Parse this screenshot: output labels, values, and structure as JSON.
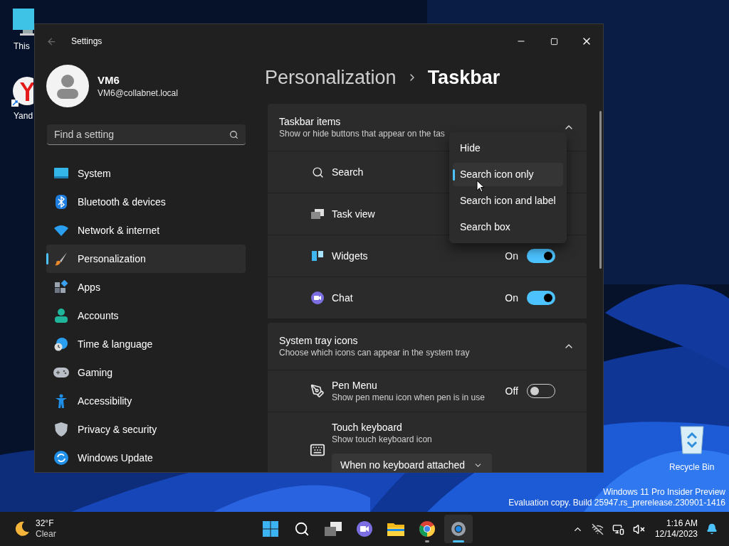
{
  "desktop": {
    "icons": [
      {
        "label": "This"
      },
      {
        "label": "Yand"
      }
    ],
    "recycle_bin": {
      "label": "Recycle Bin"
    },
    "watermark": [
      "Windows 11 Pro Insider Preview",
      "Evaluation copy. Build 25947.rs_prerelease.230901-1416"
    ]
  },
  "window": {
    "title": "Settings",
    "back_disabled": true
  },
  "profile": {
    "name": "VM6",
    "email": "VM6@collabnet.local"
  },
  "search": {
    "placeholder": "Find a setting"
  },
  "sidebar": {
    "items": [
      {
        "label": "System",
        "selected": false
      },
      {
        "label": "Bluetooth & devices",
        "selected": false
      },
      {
        "label": "Network & internet",
        "selected": false
      },
      {
        "label": "Personalization",
        "selected": true
      },
      {
        "label": "Apps",
        "selected": false
      },
      {
        "label": "Accounts",
        "selected": false
      },
      {
        "label": "Time & language",
        "selected": false
      },
      {
        "label": "Gaming",
        "selected": false
      },
      {
        "label": "Accessibility",
        "selected": false
      },
      {
        "label": "Privacy & security",
        "selected": false
      },
      {
        "label": "Windows Update",
        "selected": false
      }
    ]
  },
  "breadcrumb": [
    "Personalization",
    "Taskbar"
  ],
  "sections": [
    {
      "title": "Taskbar items",
      "subtitle": "Show or hide buttons that appear on the tas",
      "expanded": true,
      "rows": [
        {
          "kind": "plain",
          "label": "Search"
        },
        {
          "kind": "plain",
          "label": "Task view"
        },
        {
          "kind": "toggle",
          "label": "Widgets",
          "state_label": "On",
          "on": true
        },
        {
          "kind": "toggle",
          "label": "Chat",
          "state_label": "On",
          "on": true
        }
      ]
    },
    {
      "title": "System tray icons",
      "subtitle": "Choose which icons can appear in the system tray",
      "expanded": true,
      "rows": [
        {
          "kind": "toggle",
          "label": "Pen Menu",
          "description": "Show pen menu icon when pen is in use",
          "state_label": "Off",
          "on": false
        },
        {
          "kind": "select",
          "label": "Touch keyboard",
          "description": "Show touch keyboard icon",
          "value": "When no keyboard attached"
        }
      ]
    }
  ],
  "search_menu": {
    "options": [
      {
        "label": "Hide",
        "selected": false
      },
      {
        "label": "Search icon only",
        "selected": true
      },
      {
        "label": "Search icon and label",
        "selected": false
      },
      {
        "label": "Search box",
        "selected": false
      }
    ]
  },
  "taskbar": {
    "weather": {
      "temperature": "32°F",
      "condition": "Clear"
    },
    "apps": [
      {
        "running": false,
        "selected": false
      },
      {
        "running": false,
        "selected": false
      },
      {
        "running": false,
        "selected": false
      },
      {
        "running": false,
        "selected": false
      },
      {
        "running": false,
        "selected": false
      },
      {
        "running": true,
        "selected": false
      },
      {
        "running": true,
        "selected": true
      }
    ],
    "clock": {
      "time": "1:16 AM",
      "date": "12/14/2023"
    }
  }
}
